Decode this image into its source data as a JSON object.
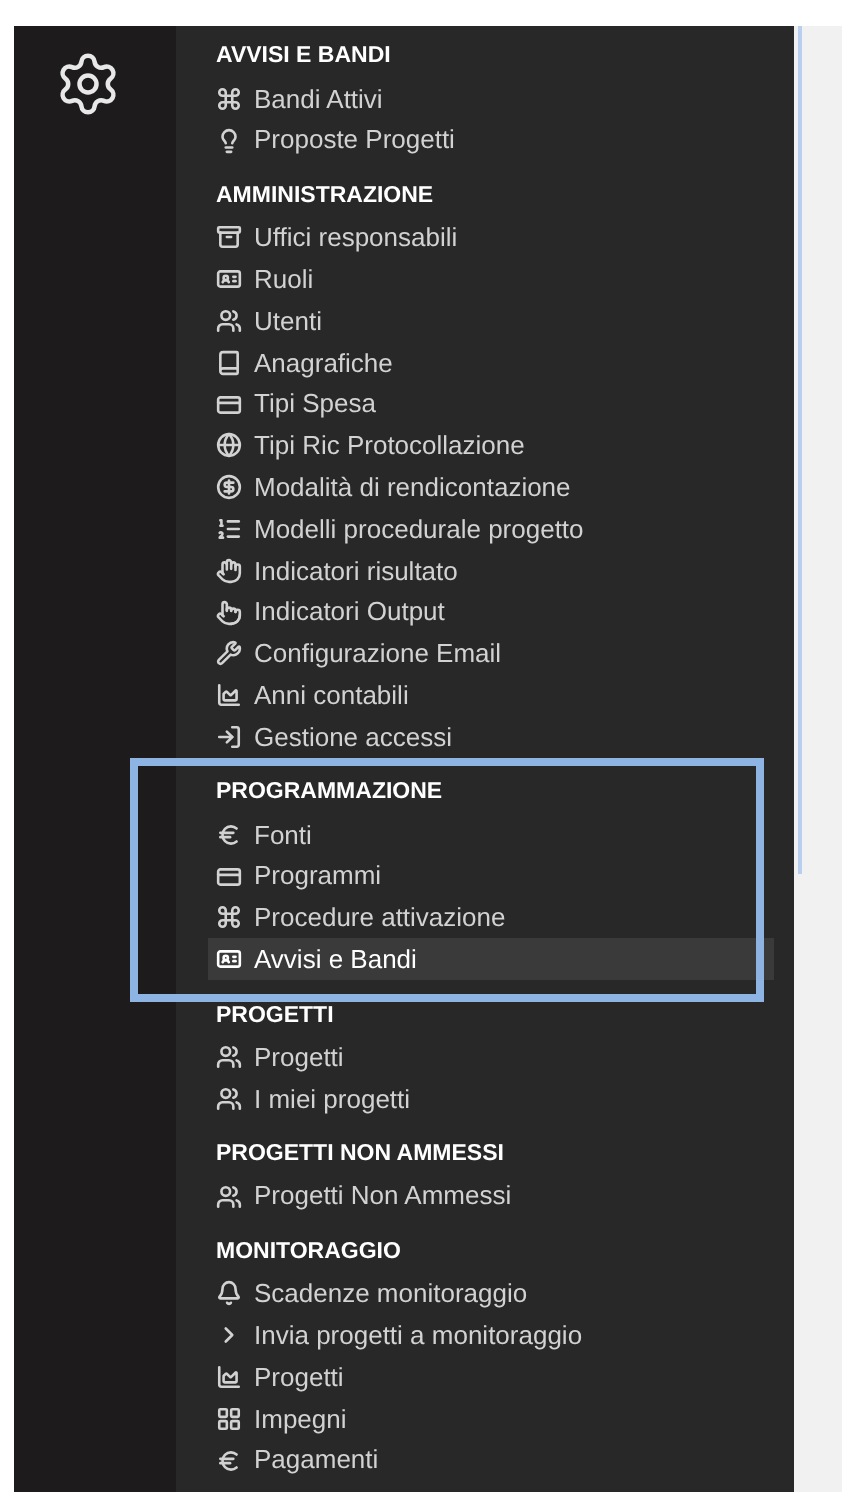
{
  "sections": [
    {
      "title": "AVVISI E BANDI",
      "items": [
        {
          "label": "Bandi Attivi",
          "selected": false
        },
        {
          "label": "Proposte Progetti",
          "selected": false
        }
      ]
    },
    {
      "title": "AMMINISTRAZIONE",
      "items": [
        {
          "label": "Uffici responsabili",
          "selected": false
        },
        {
          "label": "Ruoli",
          "selected": false
        },
        {
          "label": "Utenti",
          "selected": false
        },
        {
          "label": "Anagrafiche",
          "selected": false
        },
        {
          "label": "Tipi Spesa",
          "selected": false
        },
        {
          "label": "Tipi Ric Protocollazione",
          "selected": false
        },
        {
          "label": "Modalità di rendicontazione",
          "selected": false
        },
        {
          "label": "Modelli procedurale progetto",
          "selected": false
        },
        {
          "label": "Indicatori risultato",
          "selected": false
        },
        {
          "label": "Indicatori Output",
          "selected": false
        },
        {
          "label": "Configurazione Email",
          "selected": false
        },
        {
          "label": "Anni contabili",
          "selected": false
        },
        {
          "label": "Gestione accessi",
          "selected": false
        }
      ]
    },
    {
      "title": "PROGRAMMAZIONE",
      "items": [
        {
          "label": "Fonti",
          "selected": false
        },
        {
          "label": "Programmi",
          "selected": false
        },
        {
          "label": "Procedure attivazione",
          "selected": false
        },
        {
          "label": "Avvisi e Bandi",
          "selected": true
        }
      ]
    },
    {
      "title": "PROGETTI",
      "items": [
        {
          "label": "Progetti",
          "selected": false
        },
        {
          "label": "I miei progetti",
          "selected": false
        }
      ]
    },
    {
      "title": "PROGETTI NON AMMESSI",
      "items": [
        {
          "label": "Progetti Non Ammessi",
          "selected": false
        }
      ]
    },
    {
      "title": "MONITORAGGIO",
      "items": [
        {
          "label": "Scadenze monitoraggio",
          "selected": false
        },
        {
          "label": "Invia progetti a monitoraggio",
          "selected": false
        },
        {
          "label": "Progetti",
          "selected": false
        },
        {
          "label": "Impegni",
          "selected": false
        },
        {
          "label": "Pagamenti",
          "selected": false
        }
      ]
    }
  ]
}
